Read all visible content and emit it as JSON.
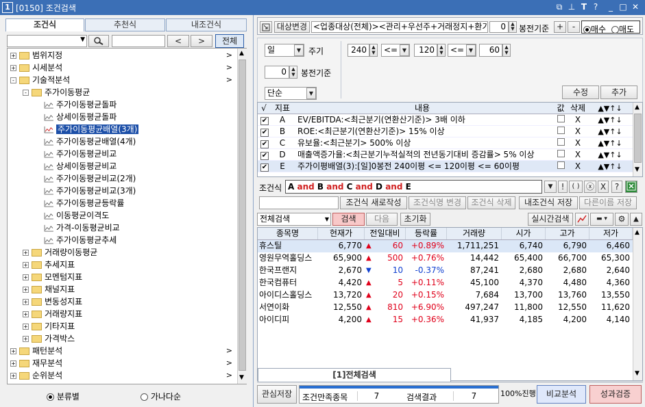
{
  "titlebar": {
    "num": "1",
    "title": "[0150] 조건검색",
    "icons": [
      "restore-grid-icon",
      "pin-icon",
      "font-icon",
      "help-icon",
      "minimize-icon",
      "maximize-icon",
      "close-icon"
    ]
  },
  "left": {
    "tabs": [
      "조건식",
      "추천식",
      "내조건식"
    ],
    "prev_label": "<",
    "next_label": ">",
    "all_label": "전체",
    "tree": [
      {
        "label": "범위지정",
        "level": 0,
        "type": "folder",
        "expander": "+",
        "arrow": ">"
      },
      {
        "label": "시세분석",
        "level": 0,
        "type": "folder",
        "expander": "+",
        "arrow": ">"
      },
      {
        "label": "기술적분석",
        "level": 0,
        "type": "folder",
        "expander": "-",
        "arrow": ">"
      },
      {
        "label": "주가이동평균",
        "level": 1,
        "type": "folder",
        "expander": "-",
        "arrow": ""
      },
      {
        "label": "주가이동평균돌파",
        "level": 2,
        "type": "chart",
        "expander": "",
        "arrow": ""
      },
      {
        "label": "상세이동평균돌파",
        "level": 2,
        "type": "chart",
        "expander": "",
        "arrow": ""
      },
      {
        "label": "주가이동평균배열(3개)",
        "level": 2,
        "type": "chart",
        "expander": "",
        "arrow": "",
        "selected": true
      },
      {
        "label": "주가이동평균배열(4개)",
        "level": 2,
        "type": "chart",
        "expander": "",
        "arrow": ""
      },
      {
        "label": "주가이동평균비교",
        "level": 2,
        "type": "chart",
        "expander": "",
        "arrow": ""
      },
      {
        "label": "상세이동평균비교",
        "level": 2,
        "type": "chart",
        "expander": "",
        "arrow": ""
      },
      {
        "label": "주가이동평균비교(2개)",
        "level": 2,
        "type": "chart",
        "expander": "",
        "arrow": ""
      },
      {
        "label": "주가이동평균비교(3개)",
        "level": 2,
        "type": "chart",
        "expander": "",
        "arrow": ""
      },
      {
        "label": "주가이동평균등락률",
        "level": 2,
        "type": "chart",
        "expander": "",
        "arrow": ""
      },
      {
        "label": "이동평균이격도",
        "level": 2,
        "type": "chart",
        "expander": "",
        "arrow": ""
      },
      {
        "label": "가격-이동평균비교",
        "level": 2,
        "type": "chart",
        "expander": "",
        "arrow": ""
      },
      {
        "label": "주가이동평균추세",
        "level": 2,
        "type": "chart",
        "expander": "",
        "arrow": ""
      },
      {
        "label": "거래량이동평균",
        "level": 1,
        "type": "folder",
        "expander": "+",
        "arrow": ""
      },
      {
        "label": "추세지표",
        "level": 1,
        "type": "folder",
        "expander": "+",
        "arrow": ""
      },
      {
        "label": "모멘텀지표",
        "level": 1,
        "type": "folder",
        "expander": "+",
        "arrow": ""
      },
      {
        "label": "채널지표",
        "level": 1,
        "type": "folder",
        "expander": "+",
        "arrow": ""
      },
      {
        "label": "변동성지표",
        "level": 1,
        "type": "folder",
        "expander": "+",
        "arrow": ""
      },
      {
        "label": "거래량지표",
        "level": 1,
        "type": "folder",
        "expander": "+",
        "arrow": ""
      },
      {
        "label": "기타지표",
        "level": 1,
        "type": "folder",
        "expander": "+",
        "arrow": ""
      },
      {
        "label": "가격박스",
        "level": 1,
        "type": "folder",
        "expander": "+",
        "arrow": ""
      },
      {
        "label": "패턴분석",
        "level": 0,
        "type": "folder",
        "expander": "+",
        "arrow": ">"
      },
      {
        "label": "재무분석",
        "level": 0,
        "type": "folder",
        "expander": "+",
        "arrow": ">"
      },
      {
        "label": "순위분석",
        "level": 0,
        "type": "folder",
        "expander": "+",
        "arrow": ">"
      }
    ],
    "radio_category": "분류별",
    "radio_alpha": "가나다순"
  },
  "top": {
    "target_change": "대상변경",
    "target_text": "<업종대상(전체)><관리+우선주+거래정지+환기종목+",
    "bong_value": "0",
    "bong_label": "봉전기준",
    "plus": "+",
    "minus": "-",
    "buy": "매수",
    "sell": "매도"
  },
  "params": {
    "period_unit": "일",
    "period_label": "주기",
    "ma1": "240",
    "op1": "<=",
    "ma2": "120",
    "op2": "<=",
    "ma3": "60",
    "bong_value": "0",
    "bong_label": "봉전기준",
    "mode": "단순",
    "edit": "수정",
    "add": "추가"
  },
  "cond_table": {
    "headers": [
      "√",
      "지표",
      "내용",
      "값",
      "삭제"
    ],
    "rows": [
      {
        "checked": true,
        "id": "A",
        "content": "EV/EBITDA:<최근분기(연환산기준)> 3배 이하",
        "del": "X"
      },
      {
        "checked": true,
        "id": "B",
        "content": "ROE:<최근분기(연환산기준)> 15% 이상",
        "del": "X"
      },
      {
        "checked": true,
        "id": "C",
        "content": "유보율:<최근분기> 500% 이상",
        "del": "X"
      },
      {
        "checked": true,
        "id": "D",
        "content": "매출액증가율:<최근분기누적실적의 전년동기대비 증감률> 5% 이상",
        "del": "X"
      },
      {
        "checked": true,
        "id": "E",
        "content": "주가이평배열(3):[일]0봉전 240이평 <= 120이평 <= 60이평",
        "del": "X"
      }
    ]
  },
  "formula": {
    "label": "조건식",
    "tokens": [
      "A",
      "and",
      "B",
      "and",
      "C",
      "and",
      "D",
      "and",
      "E"
    ],
    "btns": [
      "▼",
      "!",
      "( )",
      "ⓧ",
      "X",
      "?"
    ]
  },
  "cond_actions": [
    "조건식 새로작성",
    "조건식명 변경",
    "조건식 삭제",
    "내조건식 저장",
    "다른이름 저장"
  ],
  "search_bar": {
    "scope": "전체검색",
    "search": "검색",
    "next": "다음",
    "reset": "초기화",
    "realtime": "실시간검색"
  },
  "results": {
    "headers": [
      "종목명",
      "현재가",
      "전일대비",
      "등락률",
      "거래량",
      "시가",
      "고가",
      "저가"
    ],
    "rows": [
      {
        "name": "휴스틸",
        "price": "6,770",
        "dir": "up",
        "change": "60",
        "rate": "+0.89%",
        "volume": "1,711,251",
        "open": "6,740",
        "high": "6,790",
        "low": "6,460"
      },
      {
        "name": "영원무역홀딩스",
        "price": "65,900",
        "dir": "up",
        "change": "500",
        "rate": "+0.76%",
        "volume": "14,442",
        "open": "65,400",
        "high": "66,700",
        "low": "65,300"
      },
      {
        "name": "한국프랜지",
        "price": "2,670",
        "dir": "down",
        "change": "10",
        "rate": "-0.37%",
        "volume": "87,241",
        "open": "2,680",
        "high": "2,680",
        "low": "2,640"
      },
      {
        "name": "한국컴퓨터",
        "price": "4,420",
        "dir": "up",
        "change": "5",
        "rate": "+0.11%",
        "volume": "45,100",
        "open": "4,370",
        "high": "4,480",
        "low": "4,360"
      },
      {
        "name": "아이디스홀딩스",
        "price": "13,720",
        "dir": "up",
        "change": "20",
        "rate": "+0.15%",
        "volume": "7,684",
        "open": "13,700",
        "high": "13,760",
        "low": "13,550"
      },
      {
        "name": "서연이화",
        "price": "12,550",
        "dir": "up",
        "change": "810",
        "rate": "+6.90%",
        "volume": "497,247",
        "open": "11,800",
        "high": "12,550",
        "low": "11,620"
      },
      {
        "name": "아이디피",
        "price": "4,200",
        "dir": "up",
        "change": "15",
        "rate": "+0.36%",
        "volume": "41,937",
        "open": "4,185",
        "high": "4,200",
        "low": "4,140"
      }
    ]
  },
  "bottom_tab": "[1]전체검색",
  "status": {
    "watchlist": "관심저장",
    "match_label": "조건만족종목",
    "match_value": "7",
    "result_label": "검색결과",
    "result_value": "7",
    "progress_text": "100%진행",
    "progress": 1.0,
    "compare": "비교분석",
    "verify": "성과검증"
  }
}
